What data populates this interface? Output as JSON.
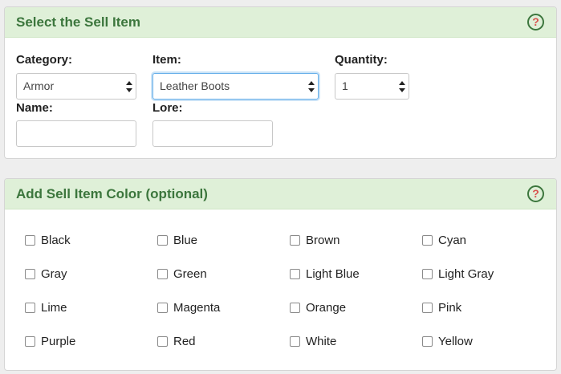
{
  "sell_item": {
    "title": "Select the Sell Item",
    "help": "?",
    "category": {
      "label": "Category:",
      "value": "Armor"
    },
    "item": {
      "label": "Item:",
      "value": "Leather Boots"
    },
    "quantity": {
      "label": "Quantity:",
      "value": "1"
    },
    "name": {
      "label": "Name:",
      "value": ""
    },
    "lore": {
      "label": "Lore:",
      "value": ""
    }
  },
  "color_panel": {
    "title": "Add Sell Item Color (optional)",
    "help": "?",
    "colors": [
      "Black",
      "Blue",
      "Brown",
      "Cyan",
      "Gray",
      "Green",
      "Light Blue",
      "Light Gray",
      "Lime",
      "Magenta",
      "Orange",
      "Pink",
      "Purple",
      "Red",
      "White",
      "Yellow"
    ]
  },
  "theme": {
    "header_bg": "#dff0d8",
    "header_text": "#3c763d",
    "help_mark": "#d9534f",
    "focus_border": "#66afe9"
  }
}
